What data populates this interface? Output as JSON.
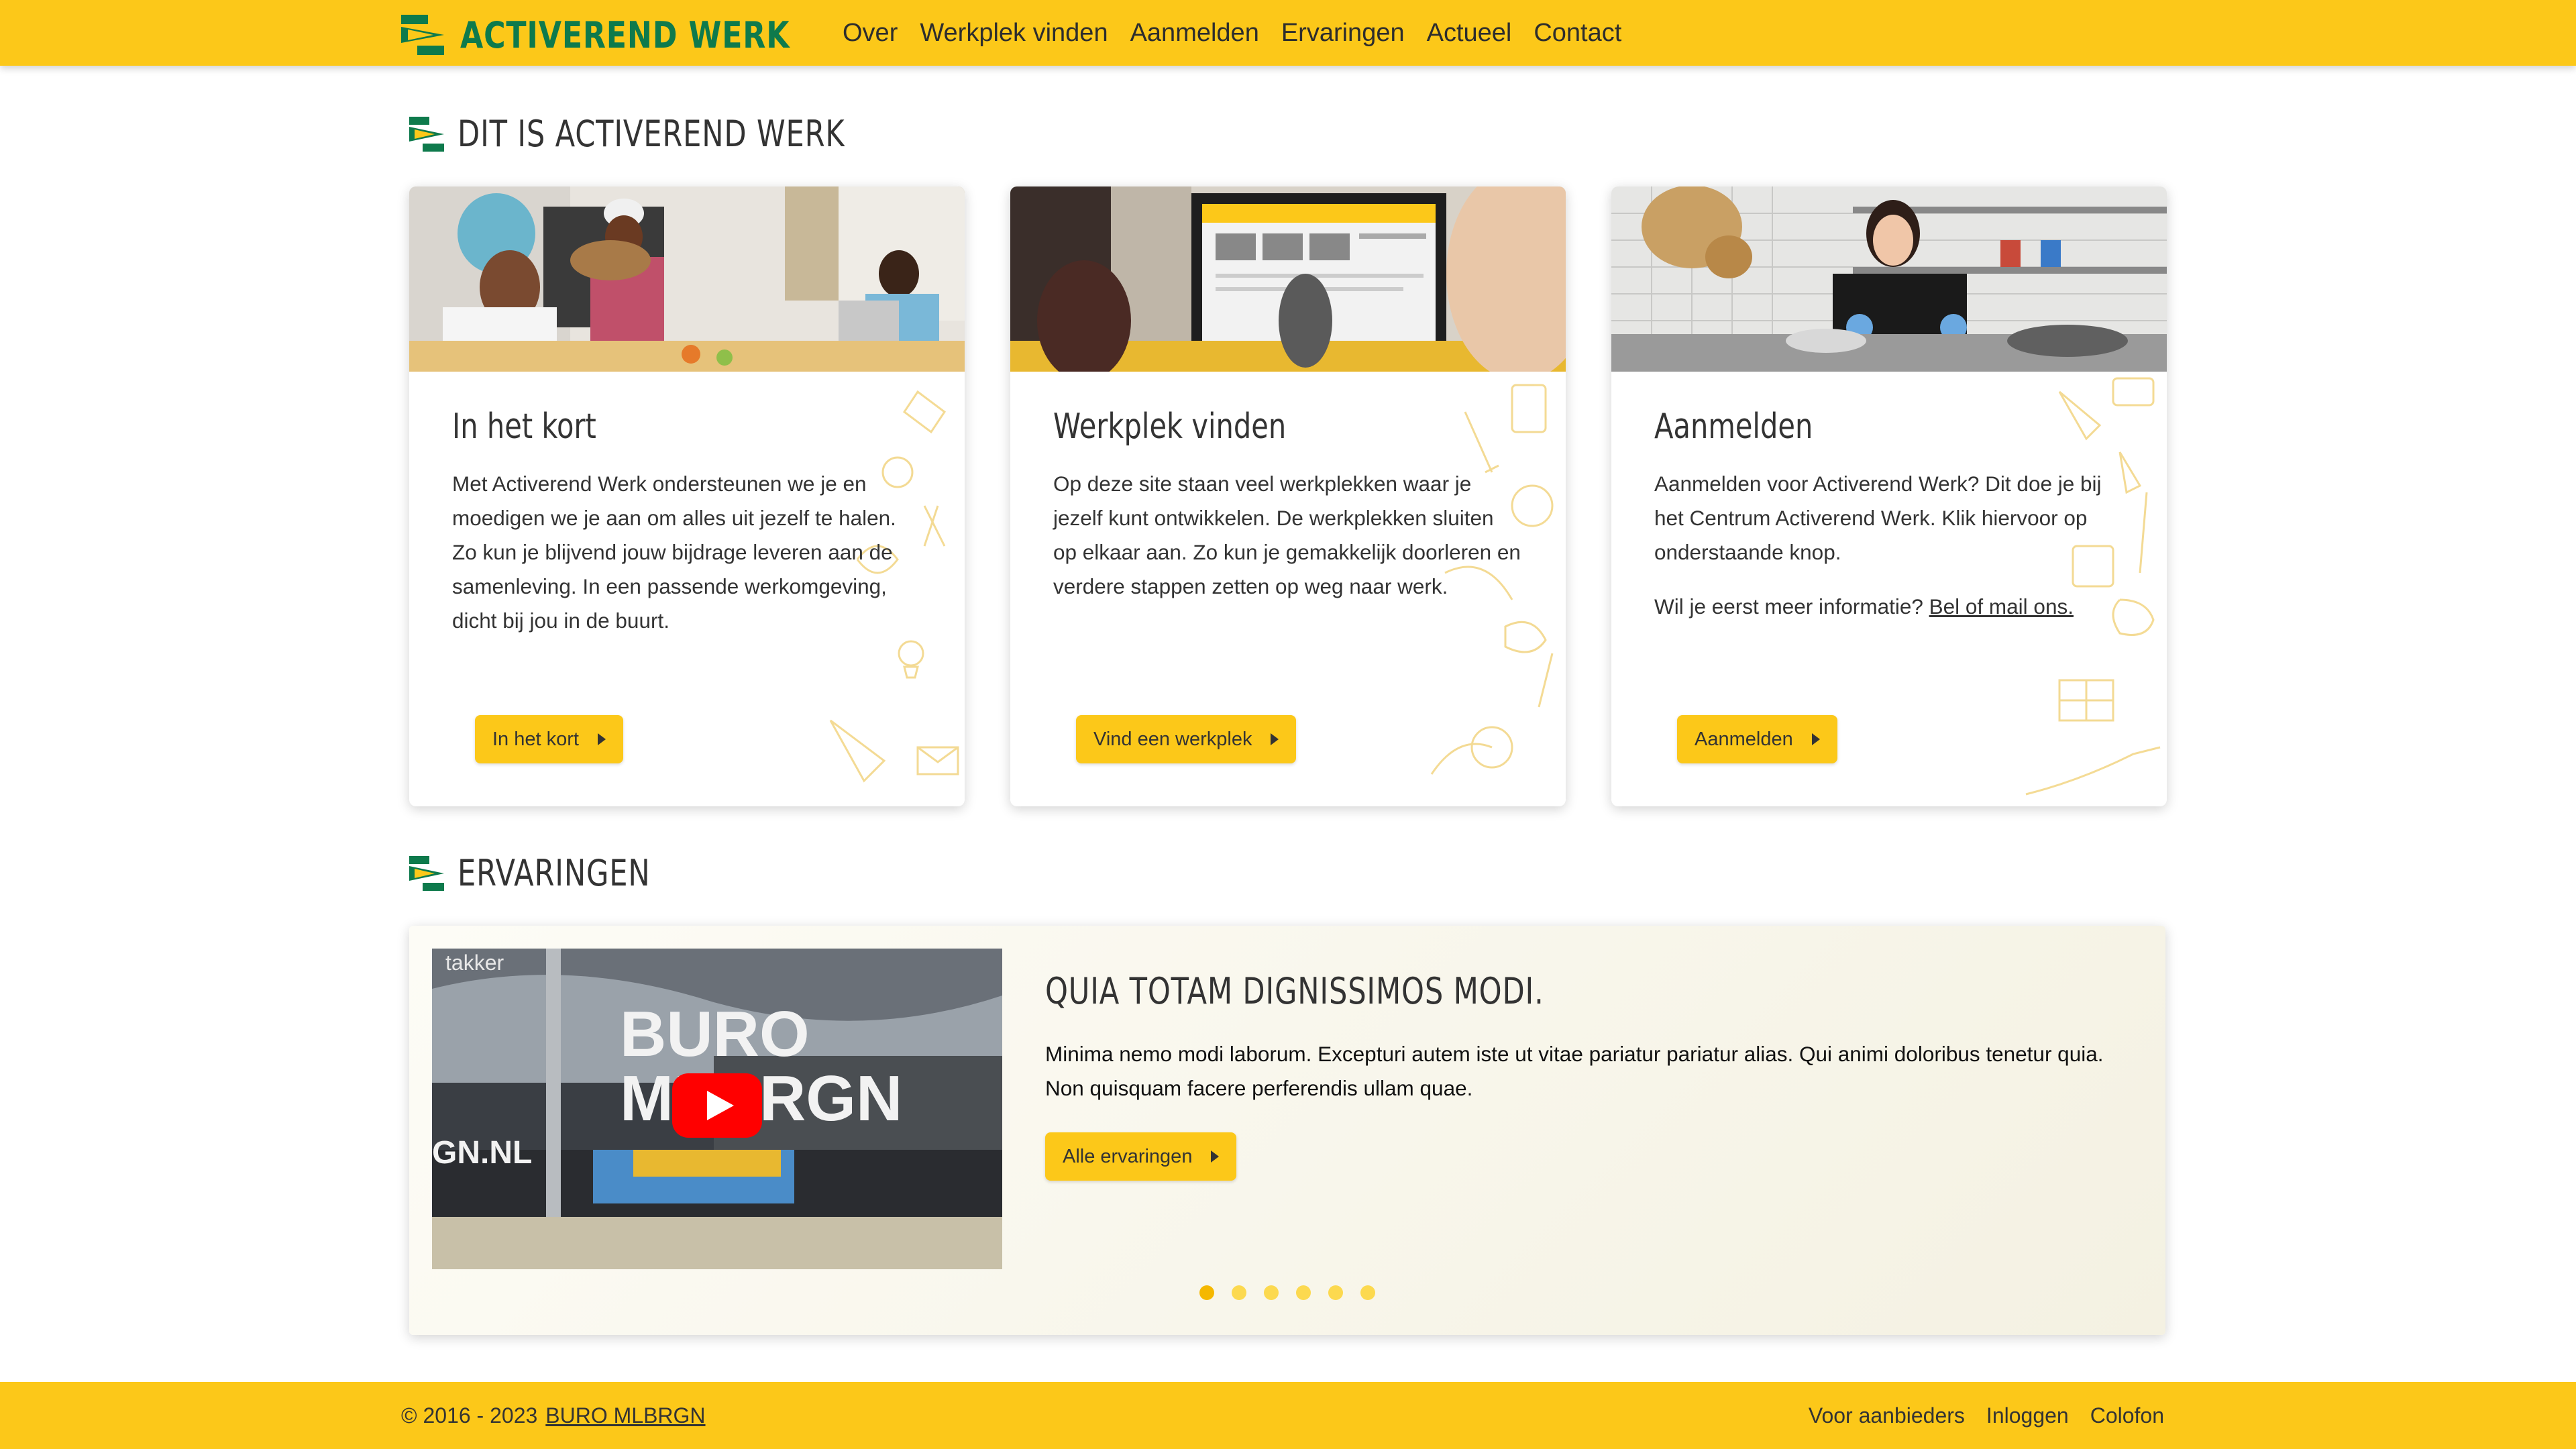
{
  "header": {
    "logo_text": "ACTIVEREND WERK",
    "nav": [
      "Over",
      "Werkplek vinden",
      "Aanmelden",
      "Ervaringen",
      "Actueel",
      "Contact"
    ]
  },
  "intro": {
    "title": "DIT IS ACTIVEREND WERK",
    "cards": [
      {
        "title": "In het kort",
        "text": "Met Activerend Werk ondersteunen we je en moedigen we je aan om alles uit jezelf te halen. Zo kun je blijvend jouw bijdrage leveren aan de samenleving. In een passende werkomgeving, dicht bij jou in de buurt.",
        "button": "In het kort"
      },
      {
        "title": "Werkplek vinden",
        "text": "Op deze site staan veel werkplekken waar je jezelf kunt ontwikkelen. De werkplekken sluiten op elkaar aan. Zo kun je gemakkelijk doorleren en verdere stappen zetten op weg naar werk.",
        "button": "Vind een werkplek"
      },
      {
        "title": "Aanmelden",
        "text": "Aanmelden voor Activerend Werk? Dit doe je bij het Centrum Activerend Werk. Klik hiervoor op onderstaande knop.",
        "text2_prefix": "Wil je eerst meer informatie? ",
        "text2_link": "Bel of mail ons.",
        "button": "Aanmelden"
      }
    ]
  },
  "experiences": {
    "title": "ERVARINGEN",
    "slide_title": "QUIA TOTAM DIGNISSIMOS MODI.",
    "slide_text": "Minima nemo modi laborum. Excepturi autem iste ut vitae pariatur pariatur alias. Qui animi doloribus tenetur quia. Non quisquam facere perferendis ullam quae.",
    "button": "Alle ervaringen",
    "video_sign_line1": "BURO",
    "video_sign_line2": "MLBRGN",
    "video_sign_line3": "GN.NL",
    "video_sign_top": "takker",
    "slide_count": 6,
    "active_slide": 1
  },
  "footer": {
    "copyright": "© 2016 - 2023",
    "company": "BURO MLBRGN",
    "links": [
      "Voor aanbieders",
      "Inloggen",
      "Colofon"
    ]
  },
  "colors": {
    "brand_yellow": "#fcc819",
    "brand_green": "#0e7a4c"
  }
}
